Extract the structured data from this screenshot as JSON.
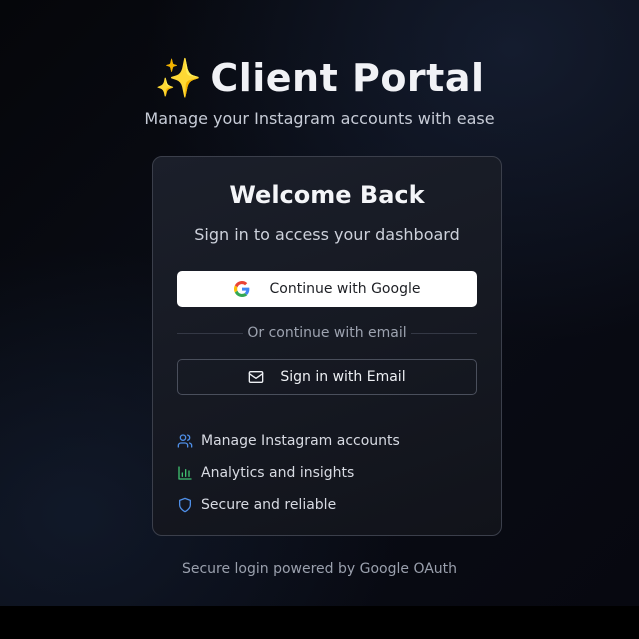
{
  "header": {
    "sparkle": "✨",
    "title": "Client Portal",
    "subtitle": "Manage your Instagram accounts with ease"
  },
  "card": {
    "title": "Welcome Back",
    "subtitle": "Sign in to access your dashboard",
    "google_button_label": "Continue with Google",
    "divider_text": "Or continue with email",
    "email_button_label": "Sign in with Email",
    "features": [
      {
        "icon": "users-icon",
        "label": "Manage Instagram accounts"
      },
      {
        "icon": "bar-chart-icon",
        "label": "Analytics and insights"
      },
      {
        "icon": "shield-icon",
        "label": "Secure and reliable"
      }
    ]
  },
  "footer": {
    "text": "Secure login powered by Google OAuth"
  },
  "colors": {
    "accent_blue": "#4f8fe8",
    "accent_green": "#3fbf6f",
    "google_button_bg": "#ffffff"
  }
}
